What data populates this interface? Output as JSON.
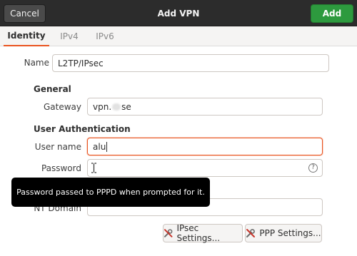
{
  "header": {
    "title": "Add VPN",
    "cancel_label": "Cancel",
    "add_label": "Add"
  },
  "tabs": [
    {
      "label": "Identity",
      "active": true
    },
    {
      "label": "IPv4",
      "active": false
    },
    {
      "label": "IPv6",
      "active": false
    }
  ],
  "identity": {
    "name_label": "Name",
    "name_value": "L2TP/IPsec"
  },
  "general": {
    "section_title": "General",
    "gateway_label": "Gateway",
    "gateway_prefix": "vpn.",
    "gateway_suffix": "se"
  },
  "user_auth": {
    "section_title": "User Authentication",
    "username_label": "User name",
    "username_value": "alu",
    "password_label": "Password",
    "password_value": "",
    "password_icon": "help-icon",
    "nt_domain_label": "NT Domain",
    "nt_domain_value": ""
  },
  "tooltip": {
    "text": "Password passed to PPPD when prompted for it."
  },
  "buttons": {
    "ipsec_label": "IPsec Settings...",
    "ppp_label": "PPP Settings...",
    "icon": "wrench-screwdriver-icon"
  },
  "colors": {
    "accent": "#e95420",
    "add_button": "#2d9a3e",
    "headerbar": "#2c2c2c",
    "tooltip_bg": "#000000"
  }
}
